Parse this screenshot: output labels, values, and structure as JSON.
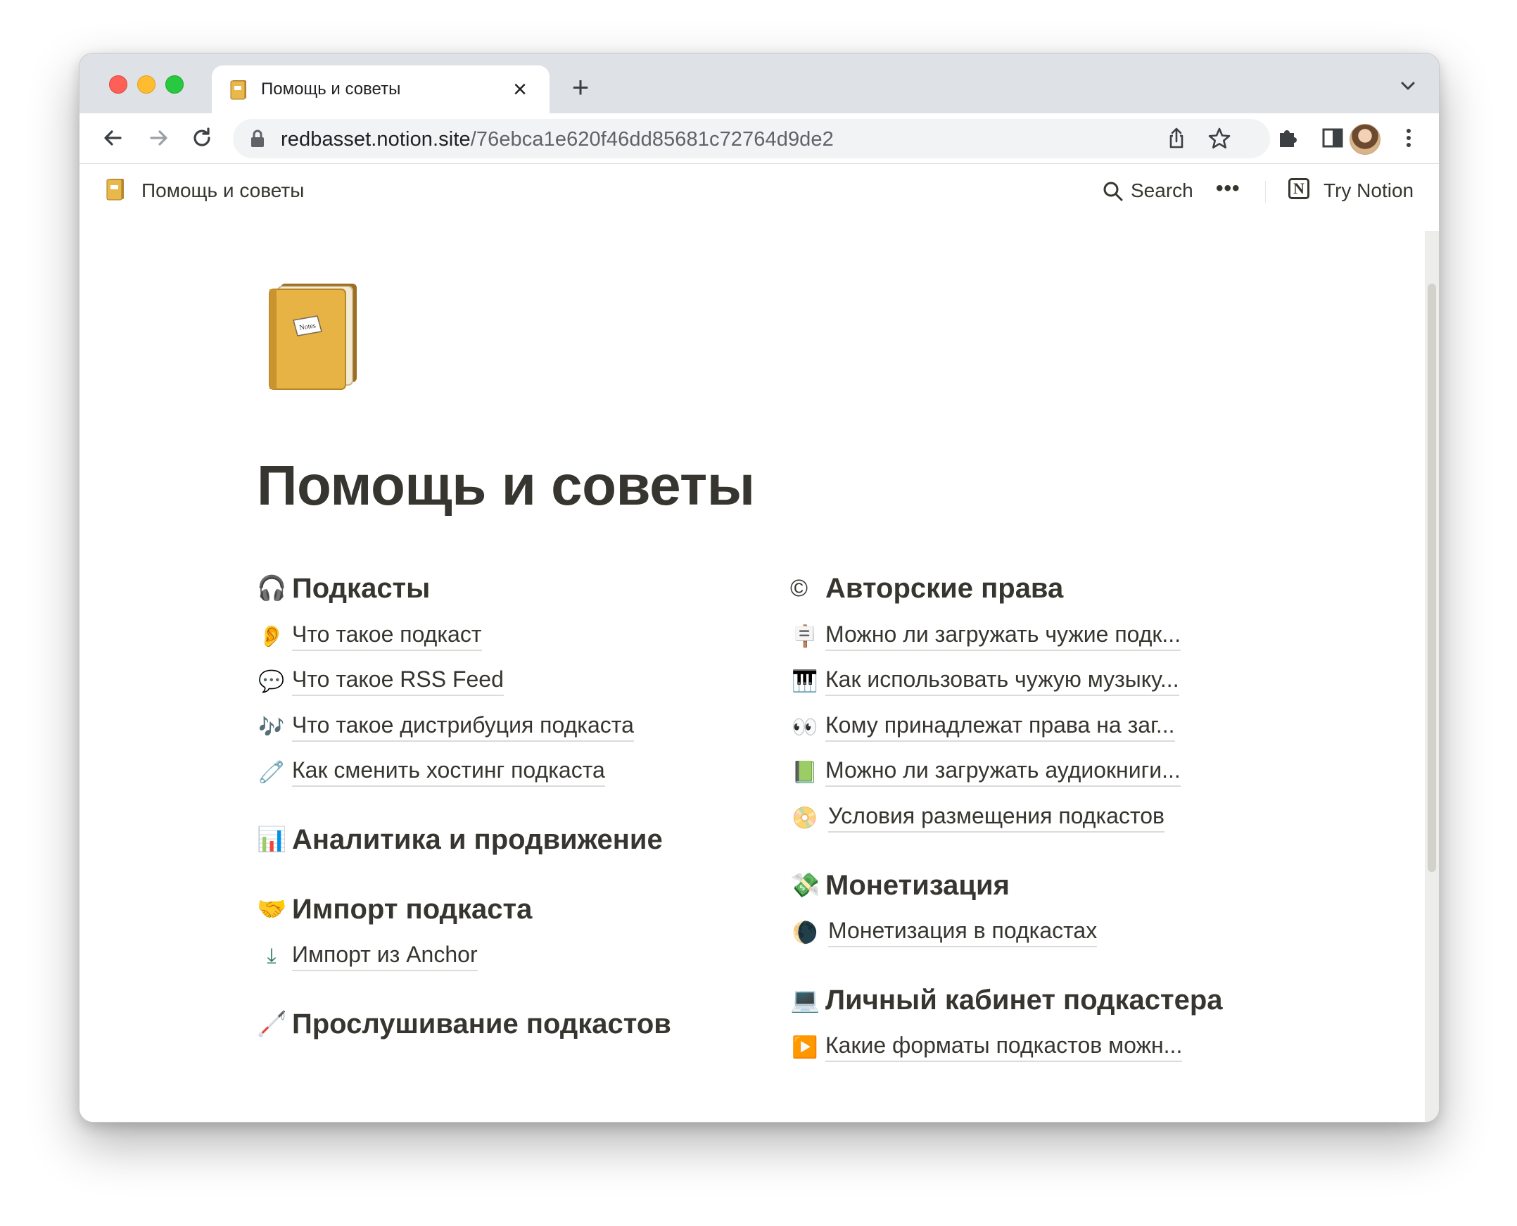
{
  "browser": {
    "tab_title": "Помощь и советы",
    "tab_close": "×",
    "new_tab": "+",
    "url_host": "redbasset.notion.site",
    "url_path": "/76ebca1e620f46dd85681c72764d9de2"
  },
  "notion_bar": {
    "breadcrumb": "Помощь и советы",
    "search_label": "Search",
    "more": "•••",
    "logo_letter": "N",
    "try_notion": "Try Notion"
  },
  "page": {
    "title": "Помощь и советы",
    "icon": "notebook-icon"
  },
  "left_column": [
    {
      "heading": "Подкасты",
      "emoji": "🎧",
      "links": [
        {
          "emoji": "👂",
          "text": "Что такое подкаст"
        },
        {
          "emoji": "💬",
          "text": "Что такое RSS Feed"
        },
        {
          "emoji": "🎶",
          "text": "Что такое дистрибуция подкаста"
        },
        {
          "emoji": "🧷",
          "text": "Как сменить хостинг подкаста"
        }
      ]
    },
    {
      "heading": "Аналитика и продвижение",
      "emoji": "📊",
      "links": []
    },
    {
      "heading": "Импорт подкаста",
      "emoji": "🤝",
      "links": [
        {
          "emoji": "⤓",
          "text": "Импорт из Anchor"
        }
      ]
    },
    {
      "heading": "Прослушивание подкастов",
      "emoji": "🦯",
      "links": []
    }
  ],
  "right_column": [
    {
      "heading": "Авторские права",
      "emoji": "©",
      "links": [
        {
          "emoji": "🪧",
          "text": "Можно ли загружать чужие подк..."
        },
        {
          "emoji": "🎹",
          "text": "Как использовать чужую музыку..."
        },
        {
          "emoji": "👀",
          "text": "Кому принадлежат права на заг..."
        },
        {
          "emoji": "📗",
          "text": "Можно ли загружать аудиокниги..."
        },
        {
          "emoji": "📀",
          "text": "Условия размещения подкастов"
        }
      ]
    },
    {
      "heading": "Монетизация",
      "emoji": "💸",
      "links": [
        {
          "emoji": "🌘",
          "text": "Монетизация в подкастах"
        }
      ]
    },
    {
      "heading": "Личный кабинет подкастера",
      "emoji": "💻",
      "links": [
        {
          "emoji": "▶️",
          "text": "Какие форматы подкастов можн..."
        }
      ]
    }
  ]
}
